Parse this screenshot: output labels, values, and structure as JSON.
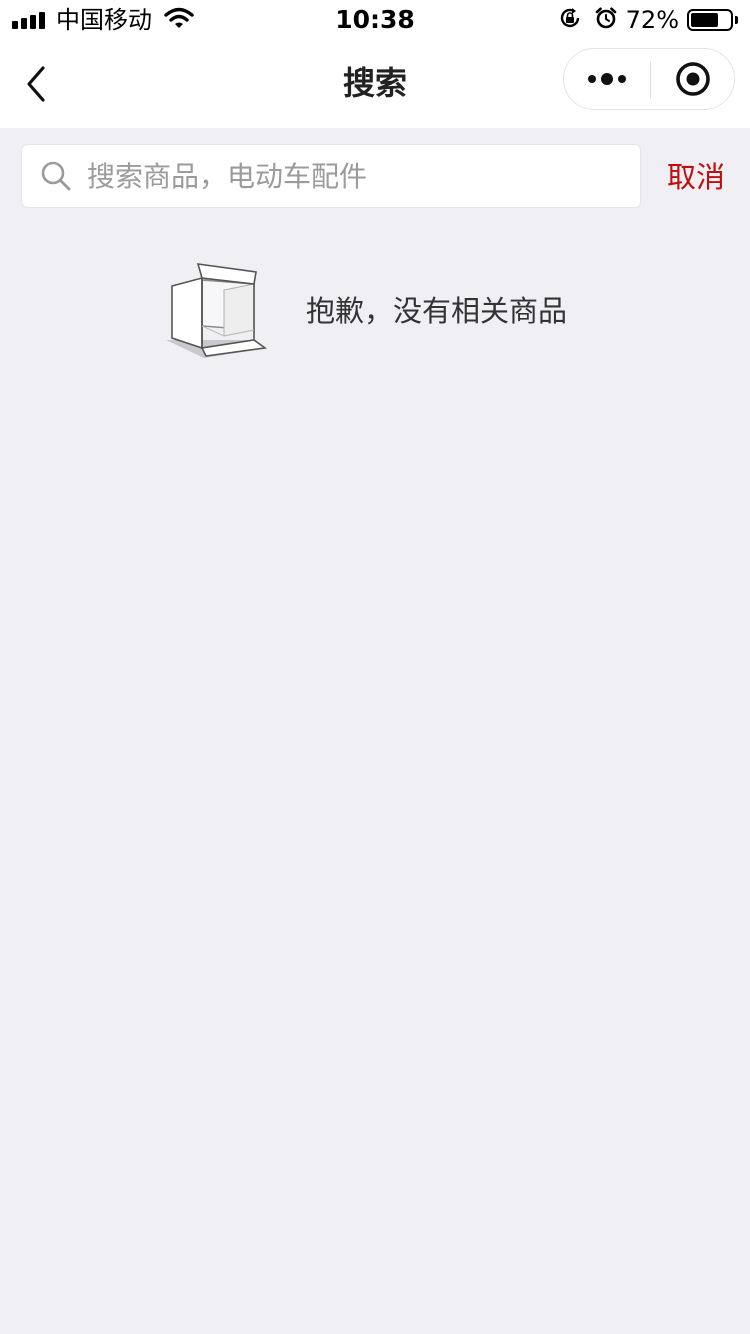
{
  "status_bar": {
    "carrier": "中国移动",
    "time": "10:38",
    "battery_percent_text": "72%",
    "battery_level": 0.72,
    "icons": [
      "signal-icon",
      "wifi-icon",
      "orientation-lock-icon",
      "alarm-icon",
      "battery-icon"
    ]
  },
  "nav": {
    "title": "搜索",
    "icons": [
      "back-chevron-icon",
      "more-dots-icon",
      "close-target-icon"
    ]
  },
  "search": {
    "placeholder": "搜索商品，电动车配件",
    "value": "",
    "cancel_label": "取消",
    "icon": "search-icon"
  },
  "empty_state": {
    "message": "抱歉，没有相关商品",
    "icon": "empty-box-icon"
  },
  "colors": {
    "accent": "#c00d0d",
    "page_background": "#efeff4",
    "bar_background": "#ffffff"
  }
}
